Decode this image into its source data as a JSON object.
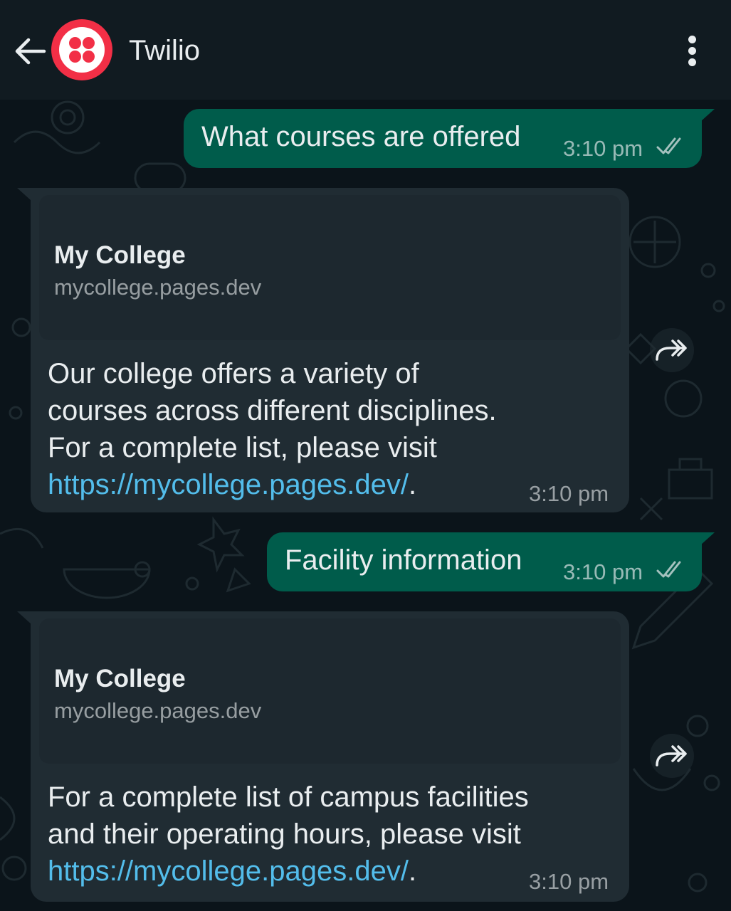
{
  "header": {
    "back_icon": "arrow-left-icon",
    "avatar_icon": "twilio-logo-icon",
    "contact_name": "Twilio",
    "menu_icon": "more-vertical-icon"
  },
  "messages": [
    {
      "direction": "outgoing",
      "text": "What courses are offered",
      "time": "3:10 pm",
      "status_icon": "double-check-icon"
    },
    {
      "direction": "incoming",
      "preview": {
        "title": "My College",
        "domain": "mycollege.pages.dev"
      },
      "lines": [
        "Our college offers a variety of",
        "courses across different disciplines.",
        "For a complete list, please visit"
      ],
      "link": "https://mycollege.pages.dev/",
      "link_suffix": ".",
      "time": "3:10 pm",
      "forward_icon": "forward-icon"
    },
    {
      "direction": "outgoing",
      "text": "Facility information",
      "time": "3:10 pm",
      "status_icon": "double-check-icon"
    },
    {
      "direction": "incoming",
      "preview": {
        "title": "My College",
        "domain": "mycollege.pages.dev"
      },
      "lines": [
        "For a complete list of campus facilities",
        "and their operating hours, please visit"
      ],
      "link": "https://mycollege.pages.dev/",
      "link_suffix": ".",
      "time": "3:10 pm",
      "forward_icon": "forward-icon"
    }
  ],
  "colors": {
    "background": "#0b141a",
    "header": "#111b21",
    "outgoing_bubble": "#005c4b",
    "incoming_bubble": "#202c33",
    "link": "#53bdeb",
    "avatar": "#f22f46"
  }
}
